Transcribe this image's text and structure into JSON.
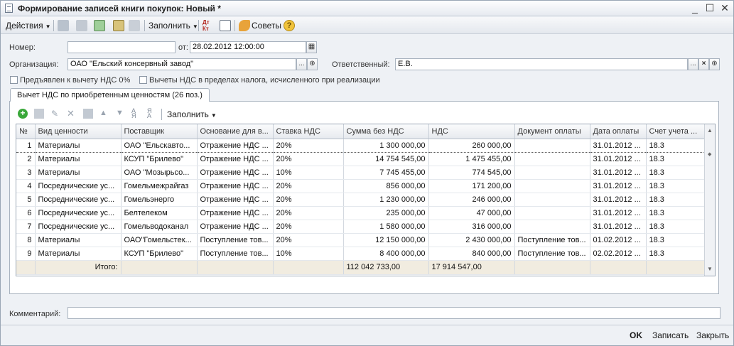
{
  "window": {
    "title": "Формирование записей книги покупок: Новый *",
    "minimize": "_",
    "maximize": "☐",
    "close": "✕"
  },
  "toolbar": {
    "actions": "Действия",
    "fill": "Заполнить",
    "tips": "Советы",
    "help": "?"
  },
  "form": {
    "number_label": "Номер:",
    "number_value": "",
    "from_label": "от:",
    "date_value": "28.02.2012 12:00:00",
    "org_label": "Организация:",
    "org_value": "ОАО \"Ельский консервный завод\"",
    "resp_label": "Ответственный:",
    "resp_value": "Е.В.",
    "dots": "...",
    "clear": "×",
    "chk1_label": "Предъявлен к вычету НДС 0%",
    "chk2_label": "Вычеты НДС в пределах налога, исчисленного при реализации"
  },
  "tab": {
    "label": "Вычет НДС по приобретенным ценностям (26 поз.)",
    "fill": "Заполнить"
  },
  "grid": {
    "columns": [
      "№",
      "Вид ценности",
      "Поставщик",
      "Основание для в...",
      "Ставка НДС",
      "Сумма без НДС",
      "НДС",
      "Документ оплаты",
      "Дата оплаты",
      "Счет учета ..."
    ],
    "rows": [
      [
        "1",
        "Материалы",
        "ОАО \"Ельскавто...",
        "Отражение НДС ...",
        "20%",
        "1 300 000,00",
        "260 000,00",
        "",
        "31.01.2012 ...",
        "18.3"
      ],
      [
        "2",
        "Материалы",
        "КСУП \"Брилево\"",
        "Отражение НДС ...",
        "20%",
        "14 754 545,00",
        "1 475 455,00",
        "",
        "31.01.2012 ...",
        "18.3"
      ],
      [
        "3",
        "Материалы",
        "ОАО \"Мозырьсо...",
        "Отражение НДС ...",
        "10%",
        "7 745 455,00",
        "774 545,00",
        "",
        "31.01.2012 ...",
        "18.3"
      ],
      [
        "4",
        "Посреднические ус...",
        "Гомельмежрайгаз",
        "Отражение НДС ...",
        "20%",
        "856 000,00",
        "171 200,00",
        "",
        "31.01.2012 ...",
        "18.3"
      ],
      [
        "5",
        "Посреднические ус...",
        "Гомельэнерго",
        "Отражение НДС ...",
        "20%",
        "1 230 000,00",
        "246 000,00",
        "",
        "31.01.2012 ...",
        "18.3"
      ],
      [
        "6",
        "Посреднические ус...",
        "Белтелеком",
        "Отражение НДС ...",
        "20%",
        "235 000,00",
        "47 000,00",
        "",
        "31.01.2012 ...",
        "18.3"
      ],
      [
        "7",
        "Посреднические ус...",
        "Гомельводоканал",
        "Отражение НДС ...",
        "20%",
        "1 580 000,00",
        "316 000,00",
        "",
        "31.01.2012 ...",
        "18.3"
      ],
      [
        "8",
        "Материалы",
        "ОАО\"Гомельстек...",
        "Поступление тов...",
        "20%",
        "12 150 000,00",
        "2 430 000,00",
        "Поступление тов...",
        "01.02.2012 ...",
        "18.3"
      ],
      [
        "9",
        "Материалы",
        "КСУП \"Брилево\"",
        "Поступление тов...",
        "10%",
        "8 400 000,00",
        "840 000,00",
        "Поступление тов...",
        "02.02.2012 ...",
        "18.3"
      ]
    ],
    "total_label": "Итого:",
    "total_sum": "112 042 733,00",
    "total_vat": "17 914 547,00"
  },
  "comment": {
    "label": "Комментарий:",
    "value": ""
  },
  "buttons": {
    "ok": "OK",
    "save": "Записать",
    "close": "Закрыть"
  },
  "icons": [
    "document-icon",
    "add-icon",
    "copy-icon",
    "edit-icon",
    "delete-icon",
    "move-up-icon",
    "move-down-icon",
    "sort-asc-icon",
    "sort-desc-icon",
    "dt-kt-icon",
    "tips-icon",
    "help-icon"
  ]
}
